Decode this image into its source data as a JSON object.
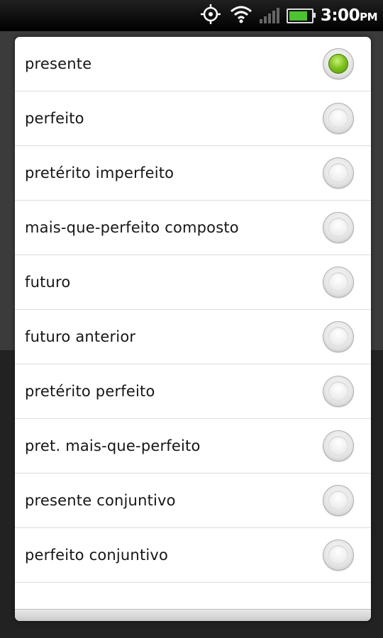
{
  "status_bar": {
    "time": "3:00",
    "ampm": "PM",
    "icons": [
      "gps-icon",
      "wifi-icon",
      "signal-icon",
      "battery-icon"
    ],
    "battery_level": 0.9
  },
  "dialog": {
    "accent_color": "#6cb21a",
    "selected_index": 0,
    "options": [
      {
        "label": "presente",
        "checked": true
      },
      {
        "label": "perfeito",
        "checked": false
      },
      {
        "label": "pretérito imperfeito",
        "checked": false
      },
      {
        "label": "mais-que-perfeito composto",
        "checked": false
      },
      {
        "label": "futuro",
        "checked": false
      },
      {
        "label": "futuro anterior",
        "checked": false
      },
      {
        "label": "pretérito perfeito",
        "checked": false
      },
      {
        "label": "pret. mais-que-perfeito",
        "checked": false
      },
      {
        "label": "presente conjuntivo",
        "checked": false
      },
      {
        "label": "perfeito conjuntivo",
        "checked": false
      }
    ]
  }
}
